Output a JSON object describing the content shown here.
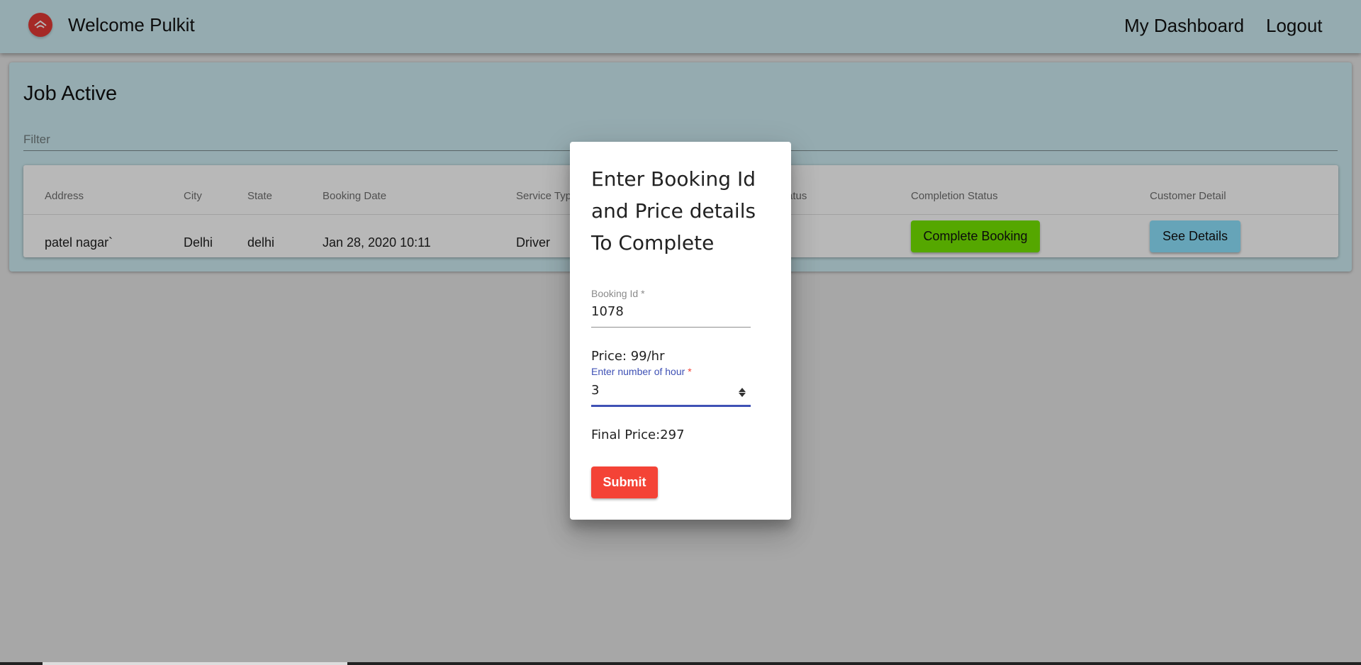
{
  "header": {
    "welcome": "Welcome Pulkit",
    "nav": {
      "dashboard": "My Dashboard",
      "logout": "Logout"
    },
    "logo_icon": "home-pin-icon"
  },
  "card": {
    "title": "Job Active",
    "filter_placeholder": "Filter",
    "columns": {
      "address": "Address",
      "city": "City",
      "state": "State",
      "booking_date": "Booking Date",
      "service_type": "Service Typ",
      "status": "atus",
      "completion_status": "Completion Status",
      "customer_detail": "Customer Detail"
    },
    "rows": [
      {
        "address": "patel nagar`",
        "city": "Delhi",
        "state": "delhi",
        "booking_date": "Jan 28, 2020 10:11",
        "service_type": "Driver",
        "complete_label": "Complete Booking",
        "details_label": "See Details"
      }
    ]
  },
  "dialog": {
    "title": "Enter Booking Id and Price details To Complete",
    "booking_id": {
      "label": "Booking Id",
      "required_mark": "*",
      "value": "1078"
    },
    "price": "Price: 99/hr",
    "hours": {
      "label": "Enter number of hour",
      "required_mark": "*",
      "value": "3"
    },
    "final_price": "Final Price:297",
    "submit_label": "Submit"
  },
  "colors": {
    "appbar": "#cfeef4",
    "complete_button": "#76e800",
    "details_button": "#8ee3ff",
    "submit_button": "#f44336",
    "focus": "#3f51b5"
  }
}
